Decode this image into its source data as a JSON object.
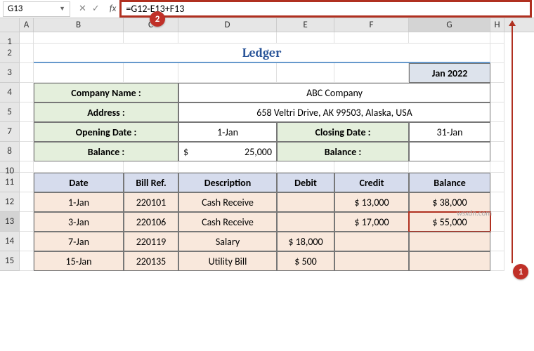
{
  "nameBox": "G13",
  "formula": "=G12-E13+F13",
  "columns": [
    "A",
    "B",
    "C",
    "D",
    "E",
    "F",
    "G",
    "H"
  ],
  "rowNums": [
    "1",
    "2",
    "3",
    "4",
    "5",
    "7",
    "8",
    "10",
    "11",
    "12",
    "13",
    "14",
    "15"
  ],
  "title": "Ledger",
  "monthHeader": "Jan 2022",
  "labels": {
    "company": "Company Name :",
    "address": "Address :",
    "openDate": "Opening Date :",
    "closeDate": "Closing Date :",
    "balance": "Balance :"
  },
  "info": {
    "company": "ABC Company",
    "address": "658 Veltri Drive, AK 99503, Alaska, USA",
    "openDate": "1-Jan",
    "closeDate": "31-Jan",
    "openBalCur": "$",
    "openBalVal": "25,000"
  },
  "tableHeaders": [
    "Date",
    "Bill Ref.",
    "Description",
    "Debit",
    "Credit",
    "Balance"
  ],
  "tableRows": [
    {
      "date": "1-Jan",
      "ref": "220101",
      "desc": "Cash Receive",
      "debit": "",
      "credit": "$   13,000",
      "bal": "$         38,000"
    },
    {
      "date": "3-Jan",
      "ref": "220106",
      "desc": "Cash Receive",
      "debit": "",
      "credit": "$   17,000",
      "bal": "$         55,000"
    },
    {
      "date": "7-Jan",
      "ref": "220119",
      "desc": "Salary",
      "debit": "$   18,000",
      "credit": "",
      "bal": ""
    },
    {
      "date": "15-Jan",
      "ref": "220135",
      "desc": "Utility Bill",
      "debit": "$        500",
      "credit": "",
      "bal": ""
    }
  ],
  "watermark": "wsxdn.com",
  "badges": {
    "b1": "1",
    "b2": "2"
  }
}
